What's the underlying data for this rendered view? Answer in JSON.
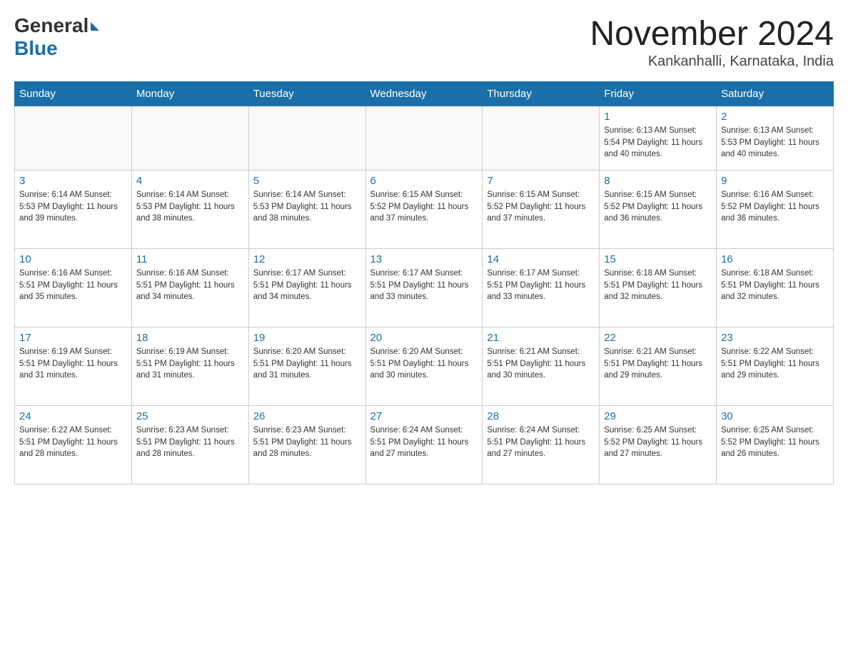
{
  "header": {
    "logo_general": "General",
    "logo_blue": "Blue",
    "title": "November 2024",
    "subtitle": "Kankanhalli, Karnataka, India"
  },
  "days_of_week": [
    "Sunday",
    "Monday",
    "Tuesday",
    "Wednesday",
    "Thursday",
    "Friday",
    "Saturday"
  ],
  "weeks": [
    [
      {
        "date": "",
        "info": ""
      },
      {
        "date": "",
        "info": ""
      },
      {
        "date": "",
        "info": ""
      },
      {
        "date": "",
        "info": ""
      },
      {
        "date": "",
        "info": ""
      },
      {
        "date": "1",
        "info": "Sunrise: 6:13 AM\nSunset: 5:54 PM\nDaylight: 11 hours and 40 minutes."
      },
      {
        "date": "2",
        "info": "Sunrise: 6:13 AM\nSunset: 5:53 PM\nDaylight: 11 hours and 40 minutes."
      }
    ],
    [
      {
        "date": "3",
        "info": "Sunrise: 6:14 AM\nSunset: 5:53 PM\nDaylight: 11 hours and 39 minutes."
      },
      {
        "date": "4",
        "info": "Sunrise: 6:14 AM\nSunset: 5:53 PM\nDaylight: 11 hours and 38 minutes."
      },
      {
        "date": "5",
        "info": "Sunrise: 6:14 AM\nSunset: 5:53 PM\nDaylight: 11 hours and 38 minutes."
      },
      {
        "date": "6",
        "info": "Sunrise: 6:15 AM\nSunset: 5:52 PM\nDaylight: 11 hours and 37 minutes."
      },
      {
        "date": "7",
        "info": "Sunrise: 6:15 AM\nSunset: 5:52 PM\nDaylight: 11 hours and 37 minutes."
      },
      {
        "date": "8",
        "info": "Sunrise: 6:15 AM\nSunset: 5:52 PM\nDaylight: 11 hours and 36 minutes."
      },
      {
        "date": "9",
        "info": "Sunrise: 6:16 AM\nSunset: 5:52 PM\nDaylight: 11 hours and 36 minutes."
      }
    ],
    [
      {
        "date": "10",
        "info": "Sunrise: 6:16 AM\nSunset: 5:51 PM\nDaylight: 11 hours and 35 minutes."
      },
      {
        "date": "11",
        "info": "Sunrise: 6:16 AM\nSunset: 5:51 PM\nDaylight: 11 hours and 34 minutes."
      },
      {
        "date": "12",
        "info": "Sunrise: 6:17 AM\nSunset: 5:51 PM\nDaylight: 11 hours and 34 minutes."
      },
      {
        "date": "13",
        "info": "Sunrise: 6:17 AM\nSunset: 5:51 PM\nDaylight: 11 hours and 33 minutes."
      },
      {
        "date": "14",
        "info": "Sunrise: 6:17 AM\nSunset: 5:51 PM\nDaylight: 11 hours and 33 minutes."
      },
      {
        "date": "15",
        "info": "Sunrise: 6:18 AM\nSunset: 5:51 PM\nDaylight: 11 hours and 32 minutes."
      },
      {
        "date": "16",
        "info": "Sunrise: 6:18 AM\nSunset: 5:51 PM\nDaylight: 11 hours and 32 minutes."
      }
    ],
    [
      {
        "date": "17",
        "info": "Sunrise: 6:19 AM\nSunset: 5:51 PM\nDaylight: 11 hours and 31 minutes."
      },
      {
        "date": "18",
        "info": "Sunrise: 6:19 AM\nSunset: 5:51 PM\nDaylight: 11 hours and 31 minutes."
      },
      {
        "date": "19",
        "info": "Sunrise: 6:20 AM\nSunset: 5:51 PM\nDaylight: 11 hours and 31 minutes."
      },
      {
        "date": "20",
        "info": "Sunrise: 6:20 AM\nSunset: 5:51 PM\nDaylight: 11 hours and 30 minutes."
      },
      {
        "date": "21",
        "info": "Sunrise: 6:21 AM\nSunset: 5:51 PM\nDaylight: 11 hours and 30 minutes."
      },
      {
        "date": "22",
        "info": "Sunrise: 6:21 AM\nSunset: 5:51 PM\nDaylight: 11 hours and 29 minutes."
      },
      {
        "date": "23",
        "info": "Sunrise: 6:22 AM\nSunset: 5:51 PM\nDaylight: 11 hours and 29 minutes."
      }
    ],
    [
      {
        "date": "24",
        "info": "Sunrise: 6:22 AM\nSunset: 5:51 PM\nDaylight: 11 hours and 28 minutes."
      },
      {
        "date": "25",
        "info": "Sunrise: 6:23 AM\nSunset: 5:51 PM\nDaylight: 11 hours and 28 minutes."
      },
      {
        "date": "26",
        "info": "Sunrise: 6:23 AM\nSunset: 5:51 PM\nDaylight: 11 hours and 28 minutes."
      },
      {
        "date": "27",
        "info": "Sunrise: 6:24 AM\nSunset: 5:51 PM\nDaylight: 11 hours and 27 minutes."
      },
      {
        "date": "28",
        "info": "Sunrise: 6:24 AM\nSunset: 5:51 PM\nDaylight: 11 hours and 27 minutes."
      },
      {
        "date": "29",
        "info": "Sunrise: 6:25 AM\nSunset: 5:52 PM\nDaylight: 11 hours and 27 minutes."
      },
      {
        "date": "30",
        "info": "Sunrise: 6:25 AM\nSunset: 5:52 PM\nDaylight: 11 hours and 26 minutes."
      }
    ]
  ]
}
